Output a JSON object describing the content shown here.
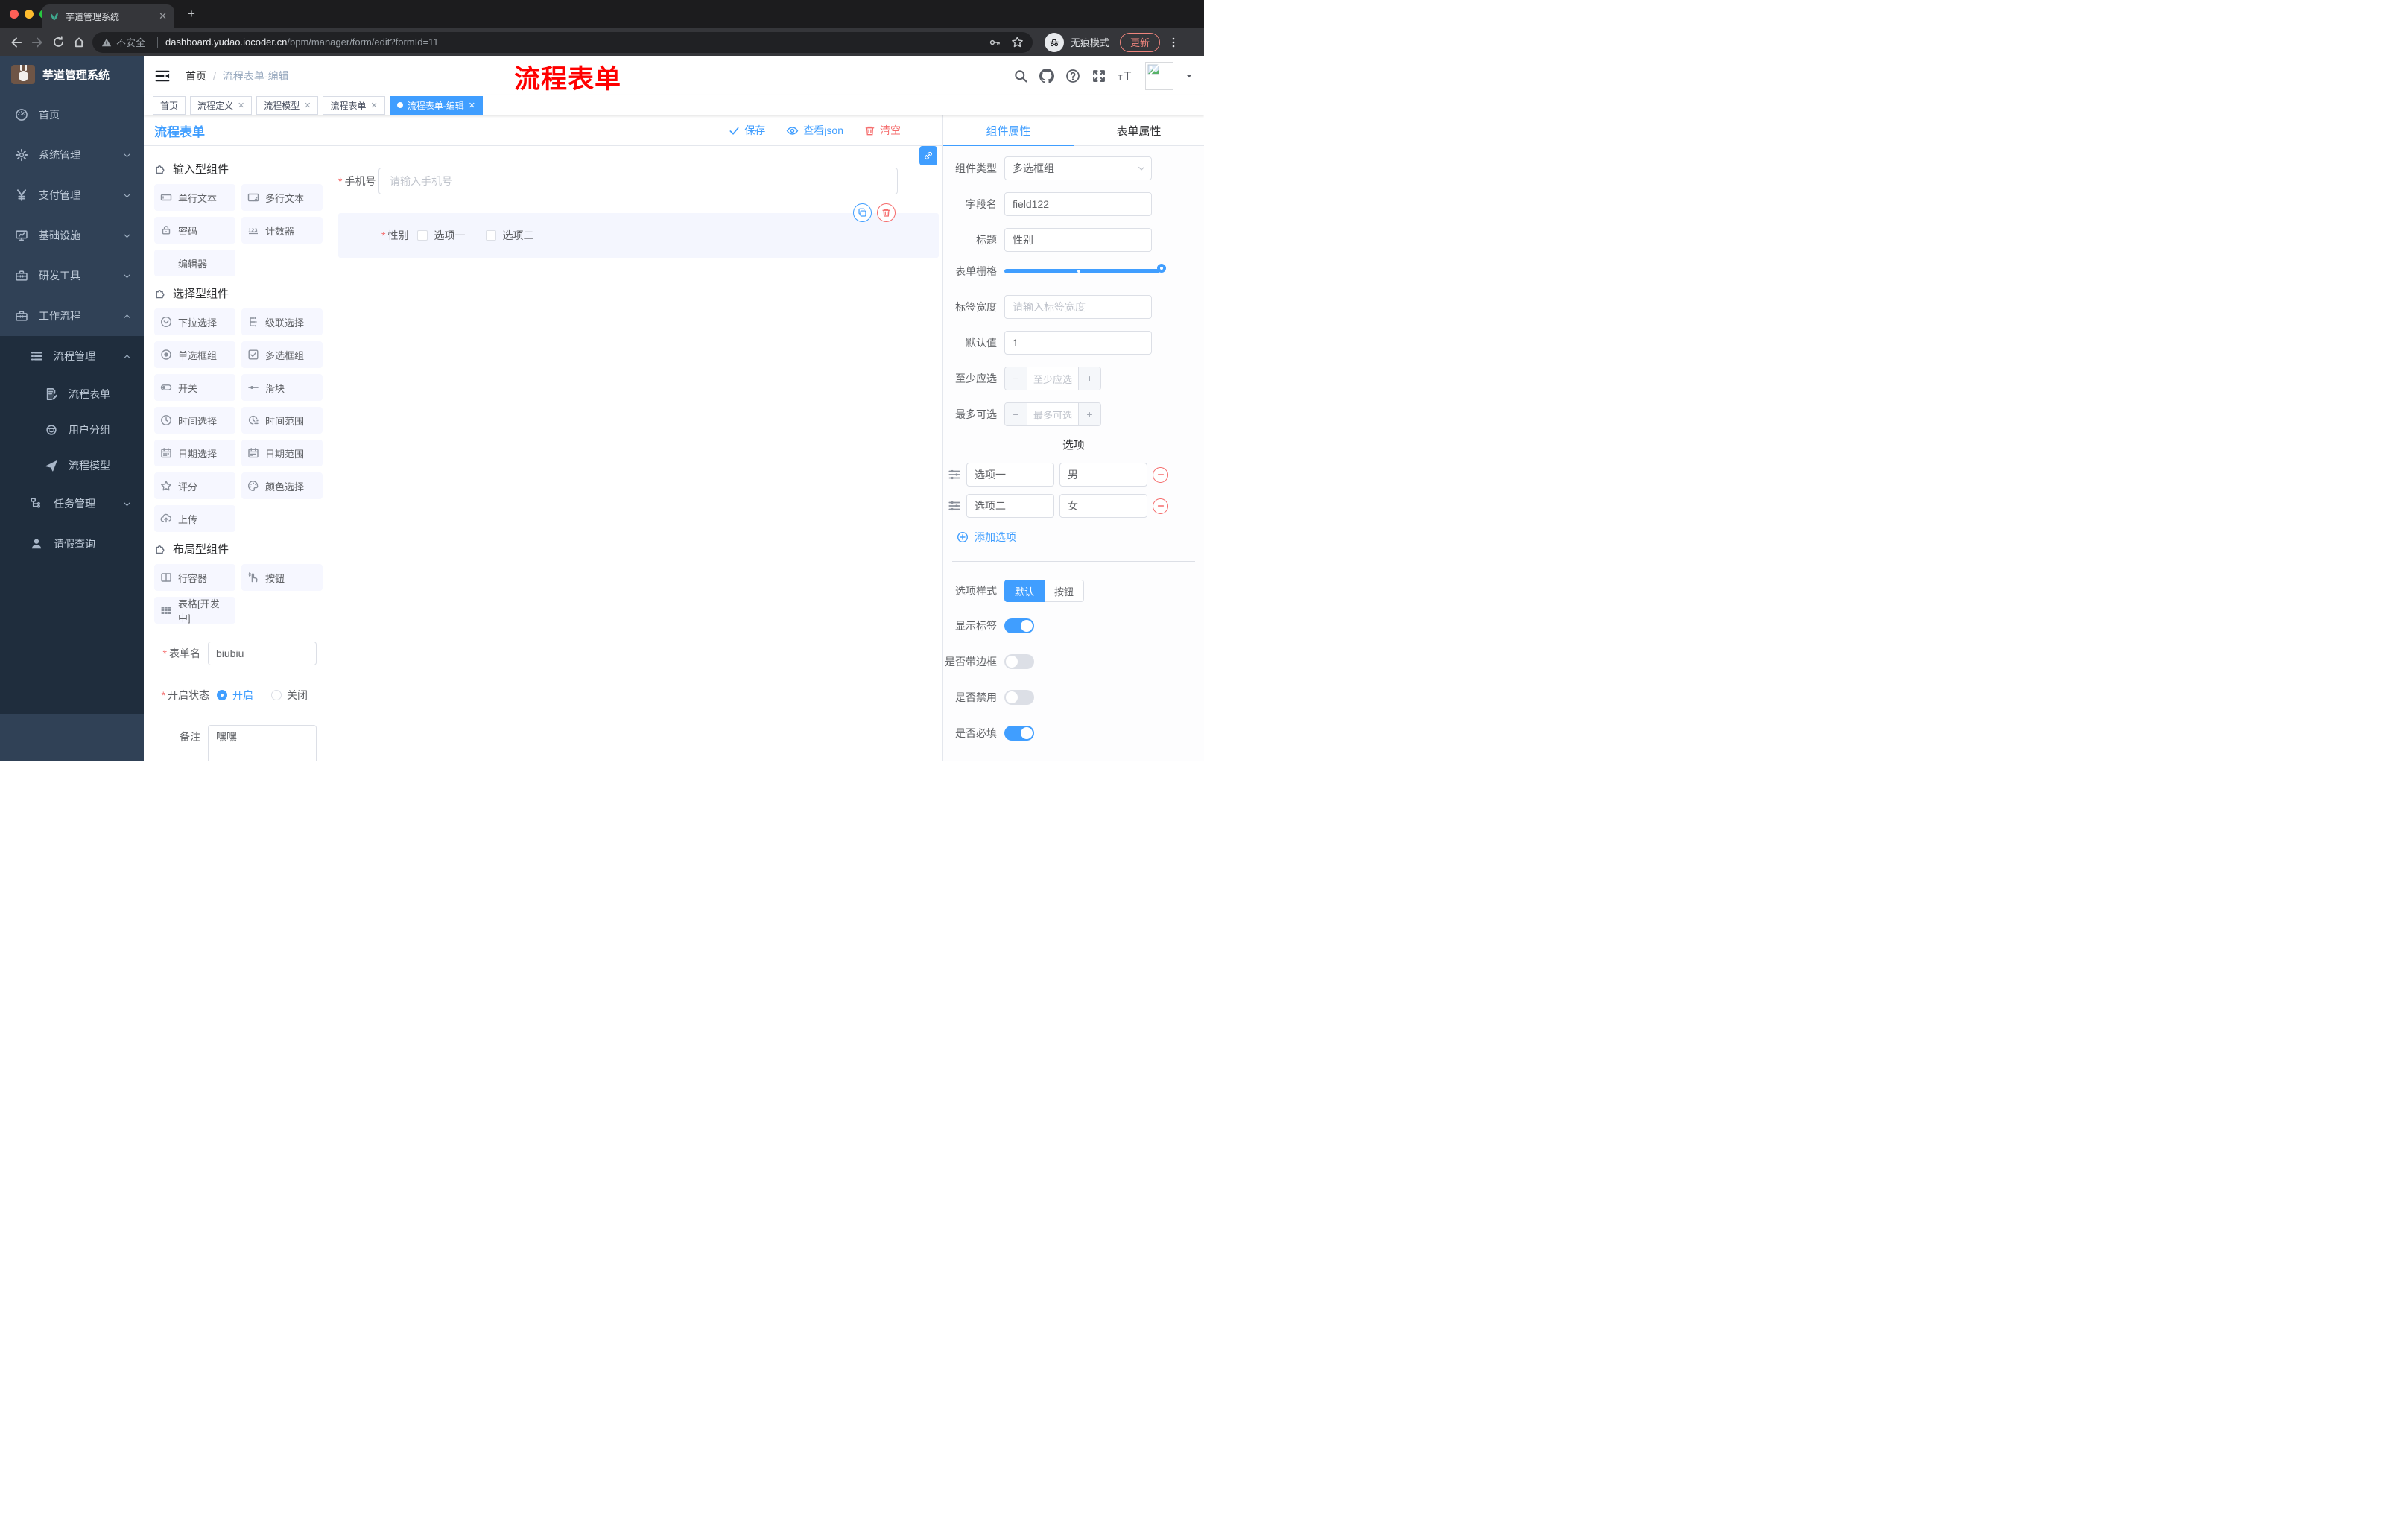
{
  "browser": {
    "tab_title": "芋道管理系统",
    "security_label": "不安全",
    "url_domain": "dashboard.yudao.iocoder.cn",
    "url_path": "/bpm/manager/form/edit?formId=11",
    "incognito_label": "无痕模式",
    "update_label": "更新"
  },
  "sidebar": {
    "logo_title": "芋道管理系统",
    "menu": [
      {
        "label": "首页",
        "icon": "dashboard-icon",
        "level": 1,
        "chevron": "",
        "dark": false
      },
      {
        "label": "系统管理",
        "icon": "gear-icon",
        "level": 1,
        "chevron": "down",
        "dark": false
      },
      {
        "label": "支付管理",
        "icon": "yen-icon",
        "level": 1,
        "chevron": "down",
        "dark": false
      },
      {
        "label": "基础设施",
        "icon": "monitor-icon",
        "level": 1,
        "chevron": "down",
        "dark": false
      },
      {
        "label": "研发工具",
        "icon": "toolbox-icon",
        "level": 1,
        "chevron": "down",
        "dark": false
      },
      {
        "label": "工作流程",
        "icon": "briefcase-icon",
        "level": 1,
        "chevron": "up",
        "dark": false
      },
      {
        "label": "流程管理",
        "icon": "list-icon",
        "level": 2,
        "chevron": "up",
        "dark": true
      },
      {
        "label": "流程表单",
        "icon": "form-edit-icon",
        "level": 3,
        "chevron": "",
        "dark": true
      },
      {
        "label": "用户分组",
        "icon": "user-group-icon",
        "level": 3,
        "chevron": "",
        "dark": true
      },
      {
        "label": "流程模型",
        "icon": "paper-plane-icon",
        "level": 3,
        "chevron": "",
        "dark": true
      },
      {
        "label": "任务管理",
        "icon": "flow-icon",
        "level": 2,
        "chevron": "down",
        "dark": true
      },
      {
        "label": "请假查询",
        "icon": "user-icon",
        "level": 2,
        "chevron": "",
        "dark": true
      }
    ]
  },
  "header": {
    "breadcrumb_home": "首页",
    "breadcrumb_current": "流程表单-编辑",
    "annotation": "流程表单"
  },
  "tags": [
    {
      "label": "首页",
      "closable": false,
      "active": false
    },
    {
      "label": "流程定义",
      "closable": true,
      "active": false
    },
    {
      "label": "流程模型",
      "closable": true,
      "active": false
    },
    {
      "label": "流程表单",
      "closable": true,
      "active": false
    },
    {
      "label": "流程表单-编辑",
      "closable": true,
      "active": true
    }
  ],
  "designer": {
    "title": "流程表单",
    "actions": {
      "save": "保存",
      "view_json": "查看json",
      "clear": "清空"
    },
    "sections": [
      {
        "title": "输入型组件",
        "items": [
          {
            "label": "单行文本",
            "icon": "text-input-icon"
          },
          {
            "label": "多行文本",
            "icon": "textarea-icon"
          },
          {
            "label": "密码",
            "icon": "password-icon"
          },
          {
            "label": "计数器",
            "icon": "counter-icon"
          },
          {
            "label": "编辑器",
            "icon": ""
          }
        ]
      },
      {
        "title": "选择型组件",
        "items": [
          {
            "label": "下拉选择",
            "icon": "select-icon"
          },
          {
            "label": "级联选择",
            "icon": "cascader-icon"
          },
          {
            "label": "单选框组",
            "icon": "radio-icon"
          },
          {
            "label": "多选框组",
            "icon": "checkbox-icon"
          },
          {
            "label": "开关",
            "icon": "switch-icon"
          },
          {
            "label": "滑块",
            "icon": "slider-icon"
          },
          {
            "label": "时间选择",
            "icon": "time-icon"
          },
          {
            "label": "时间范围",
            "icon": "time-range-icon"
          },
          {
            "label": "日期选择",
            "icon": "date-icon"
          },
          {
            "label": "日期范围",
            "icon": "date-range-icon"
          },
          {
            "label": "评分",
            "icon": "rate-icon"
          },
          {
            "label": "颜色选择",
            "icon": "color-icon"
          },
          {
            "label": "上传",
            "icon": "upload-icon"
          }
        ]
      },
      {
        "title": "布局型组件",
        "items": [
          {
            "label": "行容器",
            "icon": "row-icon"
          },
          {
            "label": "按钮",
            "icon": "button-icon"
          },
          {
            "label": "表格[开发中]",
            "icon": "table-icon"
          }
        ]
      }
    ],
    "meta": {
      "name_label": "表单名",
      "name_value": "biubiu",
      "status_label": "开启状态",
      "status_on": "开启",
      "status_off": "关闭",
      "status_selected": "开启",
      "remark_label": "备注",
      "remark_value": "嘿嘿"
    }
  },
  "canvas": {
    "phone_label": "手机号",
    "phone_placeholder": "请输入手机号",
    "gender_label": "性别",
    "gender_options": [
      "选项一",
      "选项二"
    ]
  },
  "props": {
    "tab_component": "组件属性",
    "tab_form": "表单属性",
    "component_type_label": "组件类型",
    "component_type_value": "多选框组",
    "field_name_label": "字段名",
    "field_name_value": "field122",
    "title_label": "标题",
    "title_value": "性别",
    "grid_label": "表单栅格",
    "label_width_label": "标签宽度",
    "label_width_placeholder": "请输入标签宽度",
    "default_label": "默认值",
    "default_value": "1",
    "min_label": "至少应选",
    "min_placeholder": "至少应选",
    "max_label": "最多可选",
    "max_placeholder": "最多可选",
    "options_title": "选项",
    "option_rows": [
      {
        "label": "选项一",
        "value": "男"
      },
      {
        "label": "选项二",
        "value": "女"
      }
    ],
    "add_option_label": "添加选项",
    "style_label": "选项样式",
    "style_options": [
      "默认",
      "按钮"
    ],
    "style_selected": "默认",
    "toggles": [
      {
        "label": "显示标签",
        "on": true
      },
      {
        "label": "是否带边框",
        "on": false
      },
      {
        "label": "是否禁用",
        "on": false
      },
      {
        "label": "是否必填",
        "on": true
      }
    ]
  },
  "colors": {
    "primary": "#409eff",
    "danger": "#f56c6c",
    "sidebar_bg": "#304156",
    "submenu_bg": "#1f2d3d",
    "annotation_red": "#ff0000",
    "traffic_red": "#ff5f57",
    "traffic_yellow": "#febc2e",
    "traffic_green": "#28c840"
  }
}
